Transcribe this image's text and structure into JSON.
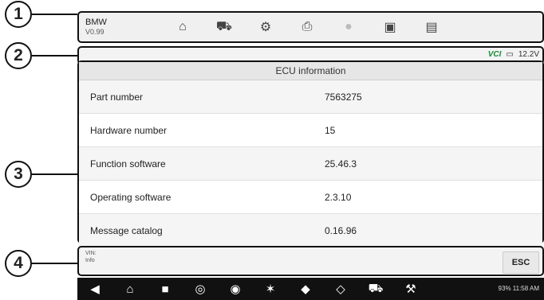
{
  "callouts": [
    "1",
    "2",
    "3",
    "4"
  ],
  "toolbar": {
    "app_name": "BMW",
    "version": "V0.99",
    "buttons": [
      "home-icon",
      "vehicle-icon",
      "settings-icon",
      "print-icon",
      "help-icon",
      "save-icon",
      "message-icon"
    ]
  },
  "status": {
    "vci": "VCI",
    "battery": "12.2V"
  },
  "table": {
    "title": "ECU information",
    "rows": [
      {
        "label": "Part number",
        "value": "7563275"
      },
      {
        "label": "Hardware number",
        "value": "15"
      },
      {
        "label": "Function software",
        "value": "25.46.3"
      },
      {
        "label": "Operating software",
        "value": "2.3.10"
      },
      {
        "label": "Message catalog",
        "value": "0.16.96"
      }
    ]
  },
  "footer": {
    "vin": "VIN:",
    "info": "Info",
    "esc": "ESC"
  },
  "navbar": {
    "status": "93% 11:58 AM"
  }
}
